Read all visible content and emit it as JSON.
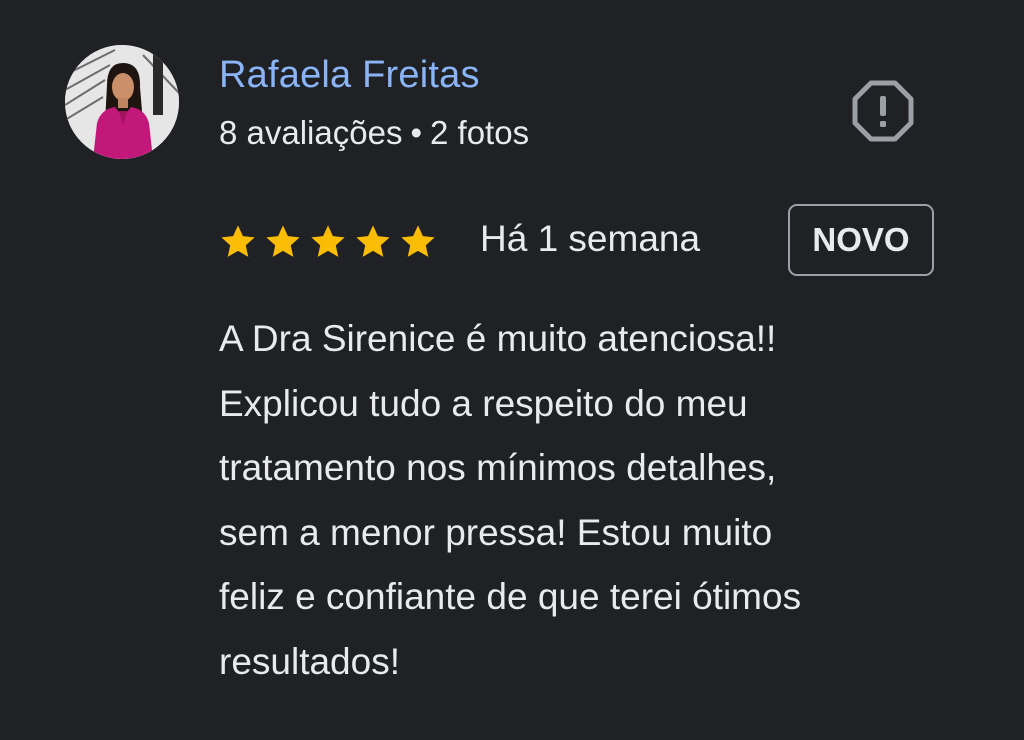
{
  "review": {
    "author": {
      "name": "Rafaela Freitas",
      "meta_reviews": "8 avaliações",
      "meta_separator": "•",
      "meta_photos": "2 fotos",
      "avatar_icon": "profile-photo"
    },
    "report_icon": "report-flag-icon",
    "rating": {
      "stars": 5,
      "max_stars": 5,
      "star_color": "#fbbc04"
    },
    "date": "Há 1 semana",
    "badge": "NOVO",
    "text": "A Dra Sirenice é muito atenciosa!!\nExplicou tudo a respeito do meu\ntratamento nos mínimos detalhes,\nsem a menor pressa! Estou muito\nfeliz e confiante de que terei ótimos\nresultados!"
  },
  "colors": {
    "background": "#202124",
    "name": "#8ab4f8",
    "text": "#e8eaed",
    "badge_border": "#9aa0a6",
    "icon": "#9aa0a6"
  }
}
